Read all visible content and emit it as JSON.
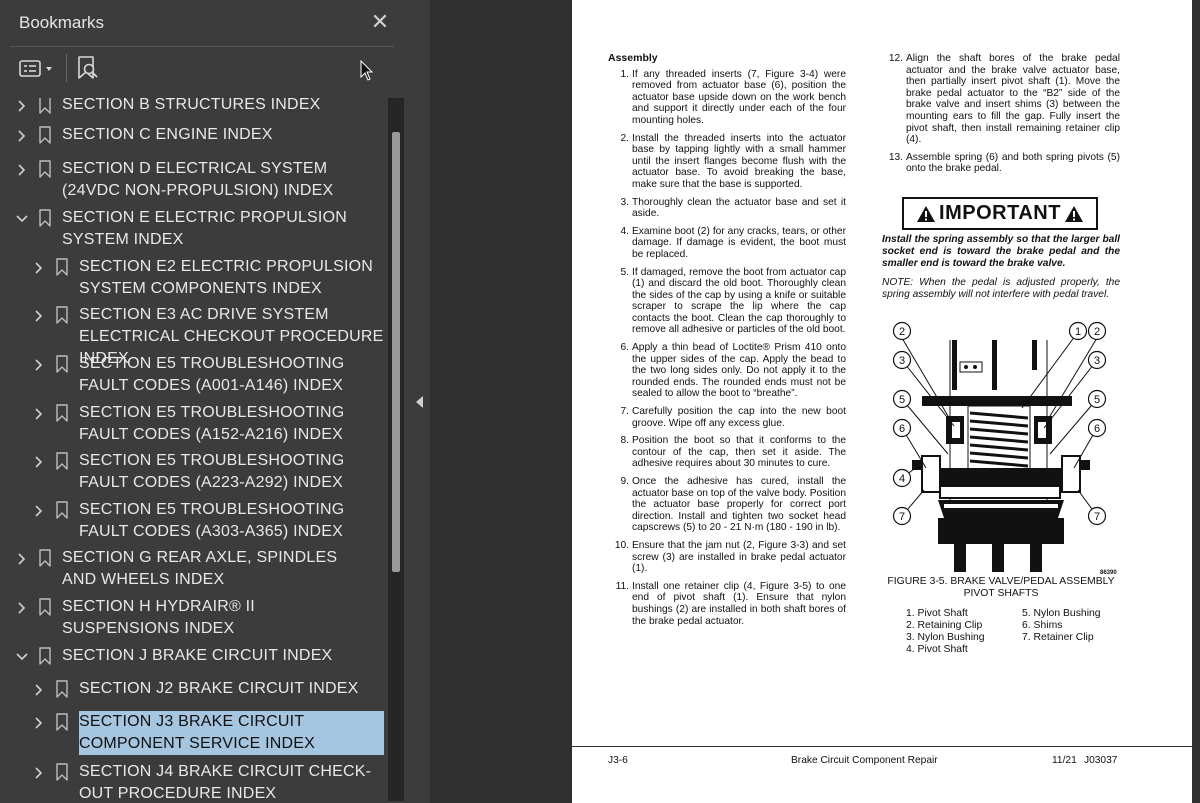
{
  "sidebar": {
    "title": "Bookmarks",
    "close_label": "✕",
    "toolbar": {
      "options_icon": "options-list-icon",
      "find_icon": "find-bookmark-icon"
    },
    "items": [
      {
        "label": "SECTION B STRUCTURES INDEX",
        "level": 0,
        "expanded": false
      },
      {
        "label": "SECTION C ENGINE INDEX",
        "level": 0,
        "expanded": false
      },
      {
        "label": "SECTION D ELECTRICAL SYSTEM (24VDC NON-PROPULSION) INDEX",
        "level": 0,
        "expanded": false
      },
      {
        "label": "SECTION E ELECTRIC PROPULSION SYSTEM INDEX",
        "level": 0,
        "expanded": true
      },
      {
        "label": "SECTION E2 ELECTRIC PROPULSION SYSTEM COMPONENTS INDEX",
        "level": 1,
        "expanded": false
      },
      {
        "label": "SECTION E3 AC DRIVE SYSTEM ELECTRICAL CHECKOUT PROCEDURE INDEX",
        "level": 1,
        "expanded": false
      },
      {
        "label": "SECTION E5 TROUBLESHOOTING FAULT CODES (A001-A146) INDEX",
        "level": 1,
        "expanded": false
      },
      {
        "label": "SECTION E5 TROUBLESHOOTING FAULT CODES (A152-A216) INDEX",
        "level": 1,
        "expanded": false
      },
      {
        "label": "SECTION E5 TROUBLESHOOTING FAULT CODES (A223-A292) INDEX",
        "level": 1,
        "expanded": false
      },
      {
        "label": "SECTION E5 TROUBLESHOOTING FAULT CODES (A303-A365) INDEX",
        "level": 1,
        "expanded": false
      },
      {
        "label": "SECTION G REAR AXLE, SPINDLES AND WHEELS INDEX",
        "level": 0,
        "expanded": false
      },
      {
        "label": "SECTION H HYDRAIR® II SUSPENSIONS INDEX",
        "level": 0,
        "expanded": false
      },
      {
        "label": "SECTION J BRAKE CIRCUIT INDEX",
        "level": 0,
        "expanded": true
      },
      {
        "label": "SECTION J2 BRAKE CIRCUIT INDEX",
        "level": 1,
        "expanded": false
      },
      {
        "label": "SECTION J3 BRAKE CIRCUIT COMPONENT SERVICE INDEX",
        "level": 1,
        "expanded": false,
        "selected": true
      },
      {
        "label": "SECTION J4 BRAKE CIRCUIT CHECK-OUT PROCEDURE INDEX",
        "level": 1,
        "expanded": false
      }
    ]
  },
  "document": {
    "section_heading": "Assembly",
    "left_steps": [
      {
        "n": "1.",
        "text": "If any threaded inserts (7, Figure 3-4) were removed from actuator base (6), position the actuator base upside down on the work bench and support it directly under each of the four mounting holes."
      },
      {
        "n": "2.",
        "text": "Install the threaded inserts into the actuator base by tapping lightly with a small hammer until the insert flanges become flush with the actuator base. To avoid breaking the base, make sure that the base is supported."
      },
      {
        "n": "3.",
        "text": "Thoroughly clean the actuator base and set it aside."
      },
      {
        "n": "4.",
        "text": "Examine boot (2) for any cracks, tears, or other damage. If damage is evident, the boot must be replaced."
      },
      {
        "n": "5.",
        "text": "If damaged, remove the boot from actuator cap (1) and discard the old boot. Thoroughly clean the sides of the cap by using a knife or suitable scraper to scrape the lip where the cap contacts the boot. Clean the cap thoroughly to remove all adhesive or particles of the old boot."
      },
      {
        "n": "6.",
        "text": "Apply a thin bead of Loctite® Prism 410 onto the upper sides of the cap. Apply the bead to the two long sides only. Do not apply it to the rounded ends. The rounded ends must not be sealed to allow the boot to “breathe”."
      },
      {
        "n": "7.",
        "text": "Carefully position the cap into the new boot groove. Wipe off any excess glue."
      },
      {
        "n": "8.",
        "text": "Position the boot so that it conforms to the contour of the cap, then set it aside. The adhesive requires about 30 minutes to cure."
      },
      {
        "n": "9.",
        "text": "Once the adhesive has cured, install the actuator base on top of the valve body. Position the actuator base properly for correct port direction. Install and tighten two socket head capscrews (5) to 20 - 21 N·m (180 - 190 in lb)."
      },
      {
        "n": "10.",
        "text": "Ensure that the jam nut (2, Figure 3-3) and set screw (3) are installed in brake pedal actuator (1)."
      },
      {
        "n": "11.",
        "text": "Install one retainer clip (4, Figure 3-5) to one end of pivot shaft (1). Ensure that nylon bushings (2) are installed in both shaft bores of the brake pedal actuator."
      }
    ],
    "right_steps": [
      {
        "n": "12.",
        "text": "Align the shaft bores of the brake pedal actuator and the brake valve actuator base, then partially insert pivot shaft (1). Move the brake pedal actuator to the “B2” side of the brake valve and insert shims (3) between the mounting ears to fill the gap. Fully insert the pivot shaft, then install remaining retainer clip (4)."
      },
      {
        "n": "13.",
        "text": "Assemble spring (6) and both spring pivots (5) onto the brake pedal."
      }
    ],
    "important_label": "IMPORTANT",
    "important_text": "Install the spring assembly so that the larger ball socket end is toward the brake pedal and the smaller end is toward the brake valve.",
    "note_text": "NOTE: When the pedal is adjusted properly, the spring assembly will not interfere with pedal travel.",
    "figure_id": "86390",
    "figure_caption": "FIGURE 3-5. BRAKE VALVE/PEDAL ASSEMBLY PIVOT SHAFTS",
    "callouts": {
      "c1": "1",
      "c2": "2",
      "c3": "3",
      "c4": "4",
      "c5": "5",
      "c6": "6",
      "c7": "7"
    },
    "legend_left": [
      "1. Pivot Shaft",
      "2. Retaining Clip",
      "3. Nylon Bushing",
      "4. Pivot Shaft"
    ],
    "legend_right": [
      "5. Nylon Bushing",
      "6. Shims",
      "7. Retainer Clip"
    ],
    "footer": {
      "page": "J3-6",
      "name": "Brake Circuit Component Repair",
      "date": "11/21",
      "code": "J03037"
    }
  }
}
